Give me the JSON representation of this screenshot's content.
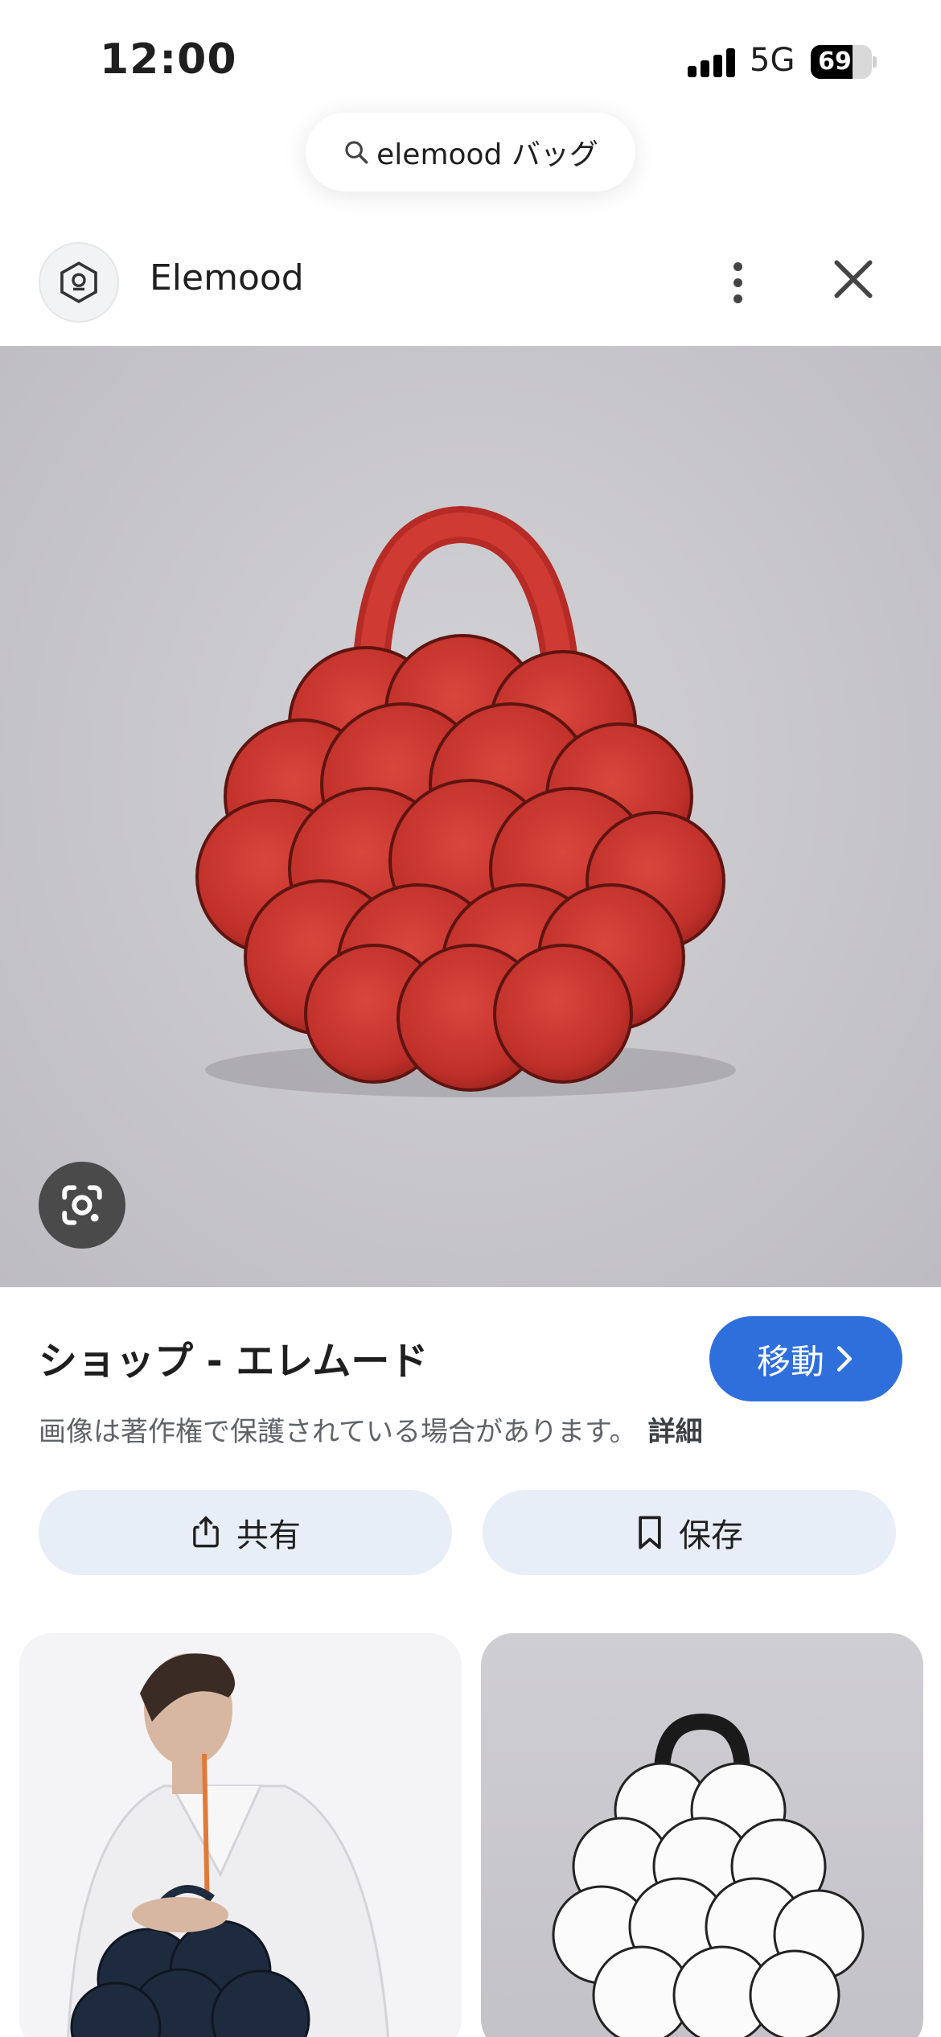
{
  "status_bar": {
    "time": "12:00",
    "network": "5G",
    "battery": "69",
    "battery_level_percent": 69
  },
  "search": {
    "query": "elemood バッグ",
    "icon": "search-icon"
  },
  "header": {
    "site_name": "Elemood",
    "more_icon": "more-vert-icon",
    "close_icon": "close-icon"
  },
  "result": {
    "title": "ショップ - エレムード",
    "visit_label": "移動",
    "copyright_notice": "画像は著作権で保護されている場合があります。",
    "details_link": "詳細"
  },
  "actions": {
    "share_label": "共有",
    "save_label": "保存"
  },
  "colors": {
    "accent": "#2f6fdc",
    "bag_red": "#c8322b",
    "action_bg": "#e8eef8"
  }
}
